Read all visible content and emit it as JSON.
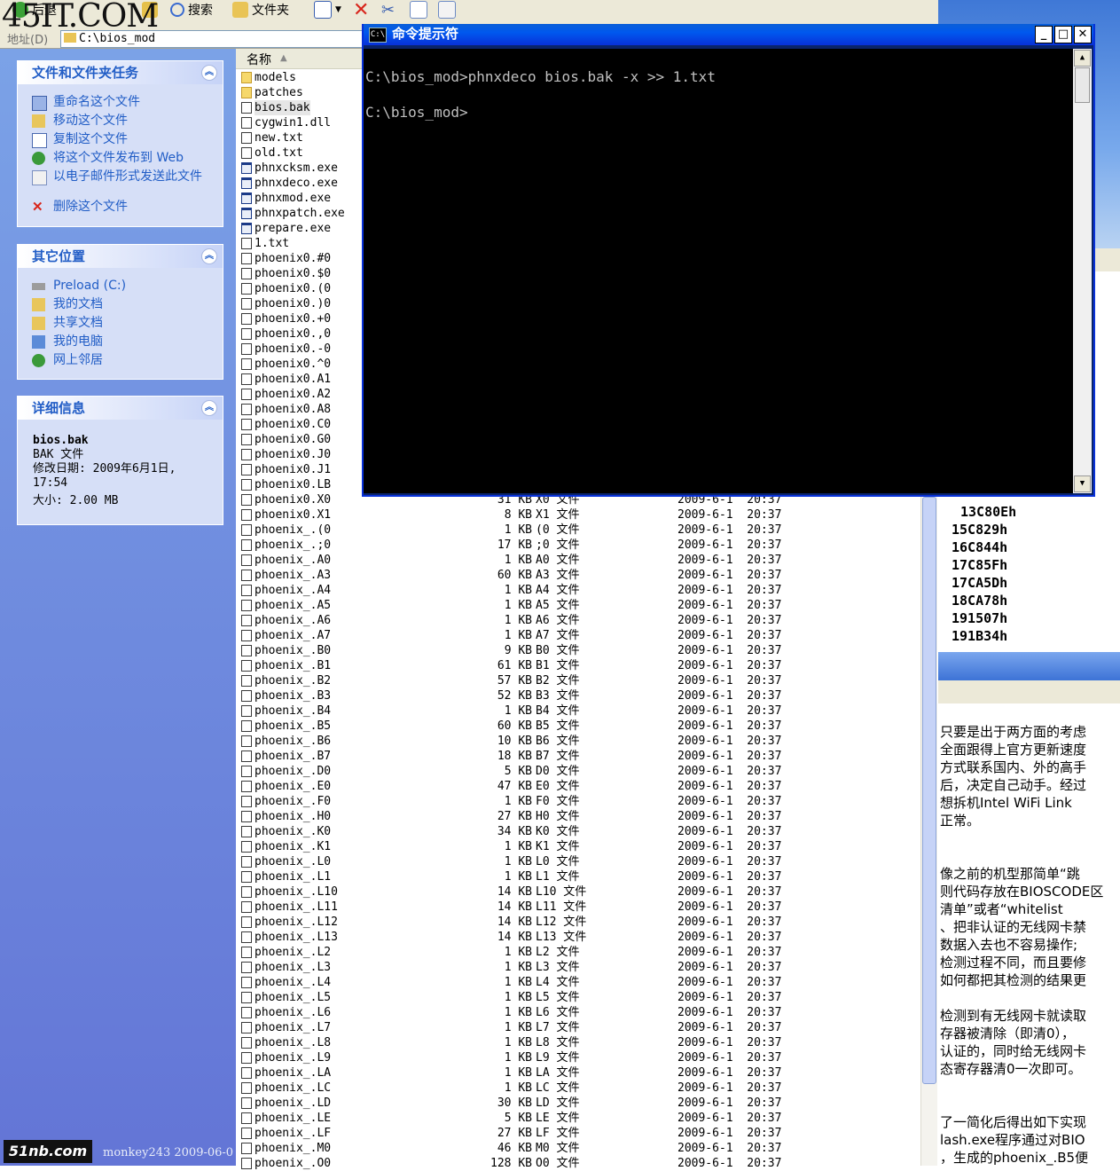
{
  "watermark": "45IT.COM",
  "toolbar": {
    "back": "后退",
    "search": "搜索",
    "folders": "文件夹"
  },
  "address": {
    "label": "地址(D)",
    "path": "C:\\bios_mod"
  },
  "taskpane": {
    "file_tasks": {
      "title": "文件和文件夹任务",
      "items": [
        "重命名这个文件",
        "移动这个文件",
        "复制这个文件",
        "将这个文件发布到 Web",
        "以电子邮件形式发送此文件",
        "删除这个文件"
      ]
    },
    "other_places": {
      "title": "其它位置",
      "items": [
        "Preload (C:)",
        "我的文档",
        "共享文档",
        "我的电脑",
        "网上邻居"
      ]
    },
    "details": {
      "title": "详细信息",
      "name": "bios.bak",
      "type": "BAK 文件",
      "modified": "修改日期: 2009年6月1日, 17:54",
      "size": "大小: 2.00 MB"
    }
  },
  "filelist": {
    "column_name": "名称",
    "hidden_rows": [
      {
        "n": "models",
        "k": "folder"
      },
      {
        "n": "patches",
        "k": "folder"
      },
      {
        "n": "bios.bak",
        "k": "file"
      },
      {
        "n": "cygwin1.dll",
        "k": "file"
      },
      {
        "n": "new.txt",
        "k": "file"
      },
      {
        "n": "old.txt",
        "k": "file"
      },
      {
        "n": "phnxcksm.exe",
        "k": "exe"
      },
      {
        "n": "phnxdeco.exe",
        "k": "exe"
      },
      {
        "n": "phnxmod.exe",
        "k": "exe"
      },
      {
        "n": "phnxpatch.exe",
        "k": "exe"
      },
      {
        "n": "prepare.exe",
        "k": "exe"
      },
      {
        "n": "1.txt",
        "k": "file"
      },
      {
        "n": "phoenix0.#0",
        "k": "file"
      },
      {
        "n": "phoenix0.$0",
        "k": "file"
      },
      {
        "n": "phoenix0.(0",
        "k": "file"
      },
      {
        "n": "phoenix0.)0",
        "k": "file"
      },
      {
        "n": "phoenix0.+0",
        "k": "file"
      },
      {
        "n": "phoenix0.,0",
        "k": "file"
      },
      {
        "n": "phoenix0.-0",
        "k": "file"
      },
      {
        "n": "phoenix0.^0",
        "k": "file"
      },
      {
        "n": "phoenix0.A1",
        "k": "file"
      },
      {
        "n": "phoenix0.A2",
        "k": "file"
      },
      {
        "n": "phoenix0.A8",
        "k": "file"
      },
      {
        "n": "phoenix0.C0",
        "k": "file"
      },
      {
        "n": "phoenix0.G0",
        "k": "file"
      },
      {
        "n": "phoenix0.J0",
        "k": "file"
      },
      {
        "n": "phoenix0.J1",
        "k": "file"
      },
      {
        "n": "phoenix0.LB",
        "k": "file"
      }
    ],
    "rows": [
      {
        "n": "phoenix0.X0",
        "s": "31 KB",
        "t": "X0 文件",
        "d": "2009-6-1  20:37"
      },
      {
        "n": "phoenix0.X1",
        "s": "8 KB",
        "t": "X1 文件",
        "d": "2009-6-1  20:37"
      },
      {
        "n": "phoenix_.(0",
        "s": "1 KB",
        "t": "(0 文件",
        "d": "2009-6-1  20:37"
      },
      {
        "n": "phoenix_.;0",
        "s": "17 KB",
        "t": ";0 文件",
        "d": "2009-6-1  20:37"
      },
      {
        "n": "phoenix_.A0",
        "s": "1 KB",
        "t": "A0 文件",
        "d": "2009-6-1  20:37"
      },
      {
        "n": "phoenix_.A3",
        "s": "60 KB",
        "t": "A3 文件",
        "d": "2009-6-1  20:37"
      },
      {
        "n": "phoenix_.A4",
        "s": "1 KB",
        "t": "A4 文件",
        "d": "2009-6-1  20:37"
      },
      {
        "n": "phoenix_.A5",
        "s": "1 KB",
        "t": "A5 文件",
        "d": "2009-6-1  20:37"
      },
      {
        "n": "phoenix_.A6",
        "s": "1 KB",
        "t": "A6 文件",
        "d": "2009-6-1  20:37"
      },
      {
        "n": "phoenix_.A7",
        "s": "1 KB",
        "t": "A7 文件",
        "d": "2009-6-1  20:37"
      },
      {
        "n": "phoenix_.B0",
        "s": "9 KB",
        "t": "B0 文件",
        "d": "2009-6-1  20:37"
      },
      {
        "n": "phoenix_.B1",
        "s": "61 KB",
        "t": "B1 文件",
        "d": "2009-6-1  20:37"
      },
      {
        "n": "phoenix_.B2",
        "s": "57 KB",
        "t": "B2 文件",
        "d": "2009-6-1  20:37"
      },
      {
        "n": "phoenix_.B3",
        "s": "52 KB",
        "t": "B3 文件",
        "d": "2009-6-1  20:37"
      },
      {
        "n": "phoenix_.B4",
        "s": "1 KB",
        "t": "B4 文件",
        "d": "2009-6-1  20:37"
      },
      {
        "n": "phoenix_.B5",
        "s": "60 KB",
        "t": "B5 文件",
        "d": "2009-6-1  20:37"
      },
      {
        "n": "phoenix_.B6",
        "s": "10 KB",
        "t": "B6 文件",
        "d": "2009-6-1  20:37"
      },
      {
        "n": "phoenix_.B7",
        "s": "18 KB",
        "t": "B7 文件",
        "d": "2009-6-1  20:37"
      },
      {
        "n": "phoenix_.D0",
        "s": "5 KB",
        "t": "D0 文件",
        "d": "2009-6-1  20:37"
      },
      {
        "n": "phoenix_.E0",
        "s": "47 KB",
        "t": "E0 文件",
        "d": "2009-6-1  20:37"
      },
      {
        "n": "phoenix_.F0",
        "s": "1 KB",
        "t": "F0 文件",
        "d": "2009-6-1  20:37"
      },
      {
        "n": "phoenix_.H0",
        "s": "27 KB",
        "t": "H0 文件",
        "d": "2009-6-1  20:37"
      },
      {
        "n": "phoenix_.K0",
        "s": "34 KB",
        "t": "K0 文件",
        "d": "2009-6-1  20:37"
      },
      {
        "n": "phoenix_.K1",
        "s": "1 KB",
        "t": "K1 文件",
        "d": "2009-6-1  20:37"
      },
      {
        "n": "phoenix_.L0",
        "s": "1 KB",
        "t": "L0 文件",
        "d": "2009-6-1  20:37"
      },
      {
        "n": "phoenix_.L1",
        "s": "1 KB",
        "t": "L1 文件",
        "d": "2009-6-1  20:37"
      },
      {
        "n": "phoenix_.L10",
        "s": "14 KB",
        "t": "L10 文件",
        "d": "2009-6-1  20:37"
      },
      {
        "n": "phoenix_.L11",
        "s": "14 KB",
        "t": "L11 文件",
        "d": "2009-6-1  20:37"
      },
      {
        "n": "phoenix_.L12",
        "s": "14 KB",
        "t": "L12 文件",
        "d": "2009-6-1  20:37"
      },
      {
        "n": "phoenix_.L13",
        "s": "14 KB",
        "t": "L13 文件",
        "d": "2009-6-1  20:37"
      },
      {
        "n": "phoenix_.L2",
        "s": "1 KB",
        "t": "L2 文件",
        "d": "2009-6-1  20:37"
      },
      {
        "n": "phoenix_.L3",
        "s": "1 KB",
        "t": "L3 文件",
        "d": "2009-6-1  20:37"
      },
      {
        "n": "phoenix_.L4",
        "s": "1 KB",
        "t": "L4 文件",
        "d": "2009-6-1  20:37"
      },
      {
        "n": "phoenix_.L5",
        "s": "1 KB",
        "t": "L5 文件",
        "d": "2009-6-1  20:37"
      },
      {
        "n": "phoenix_.L6",
        "s": "1 KB",
        "t": "L6 文件",
        "d": "2009-6-1  20:37"
      },
      {
        "n": "phoenix_.L7",
        "s": "1 KB",
        "t": "L7 文件",
        "d": "2009-6-1  20:37"
      },
      {
        "n": "phoenix_.L8",
        "s": "1 KB",
        "t": "L8 文件",
        "d": "2009-6-1  20:37"
      },
      {
        "n": "phoenix_.L9",
        "s": "1 KB",
        "t": "L9 文件",
        "d": "2009-6-1  20:37"
      },
      {
        "n": "phoenix_.LA",
        "s": "1 KB",
        "t": "LA 文件",
        "d": "2009-6-1  20:37"
      },
      {
        "n": "phoenix_.LC",
        "s": "1 KB",
        "t": "LC 文件",
        "d": "2009-6-1  20:37"
      },
      {
        "n": "phoenix_.LD",
        "s": "30 KB",
        "t": "LD 文件",
        "d": "2009-6-1  20:37"
      },
      {
        "n": "phoenix_.LE",
        "s": "5 KB",
        "t": "LE 文件",
        "d": "2009-6-1  20:37"
      },
      {
        "n": "phoenix_.LF",
        "s": "27 KB",
        "t": "LF 文件",
        "d": "2009-6-1  20:37"
      },
      {
        "n": "phoenix_.M0",
        "s": "46 KB",
        "t": "M0 文件",
        "d": "2009-6-1  20:37"
      },
      {
        "n": "phoenix_.O0",
        "s": "128 KB",
        "t": "O0 文件",
        "d": "2009-6-1  20:37"
      }
    ]
  },
  "cmd": {
    "title": "命令提示符",
    "lines": [
      "C:\\bios_mod>phnxdeco bios.bak -x >> 1.txt",
      "",
      "C:\\bios_mod>"
    ]
  },
  "rightwin": {
    "hex": [
      "13C80Eh",
      "15C829h",
      "16C844h",
      "17C85Fh",
      "17CA5Dh",
      "18CA78h",
      "191507h",
      "191B34h"
    ],
    "text": [
      "只要是出于两方面的考虑",
      "全面跟得上官方更新速度",
      "方式联系国内、外的高手",
      "后，决定自己动手。经过",
      "想拆机Intel WiFi Link",
      "正常。",
      "",
      "",
      "像之前的机型那简单“跳",
      "则代码存放在BIOSCODE区",
      "清单”或者“whitelist",
      "、把非认证的无线网卡禁",
      "数据入去也不容易操作;",
      "检测过程不同，而且要修",
      "如何都把其检测的结果更",
      "",
      "检测到有无线网卡就读取",
      "存器被清除（即清0），",
      "认证的，同时给无线网卡",
      "态寄存器清0一次即可。",
      "",
      "",
      "了一简化后得出如下实现",
      "lash.exe程序通过对BIO",
      "，生成的phoenix_.B5便"
    ]
  },
  "overlay": {
    "logo": "51nb.com",
    "signature": "monkey243  2009-06-0"
  }
}
